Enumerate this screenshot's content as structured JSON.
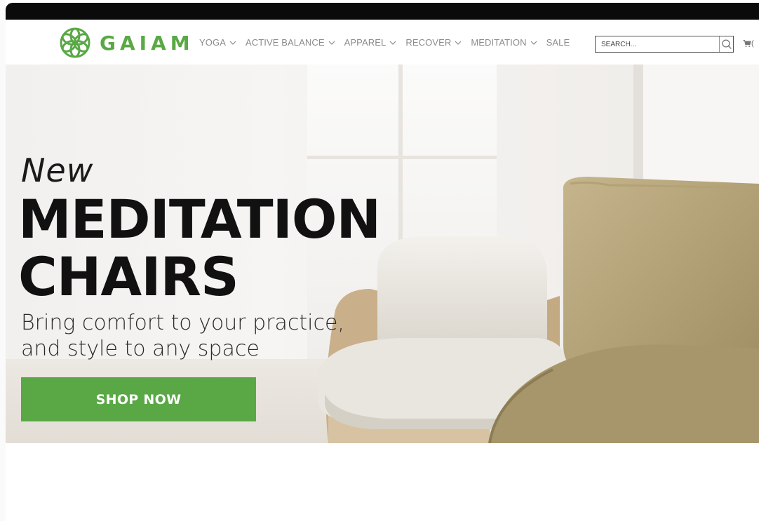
{
  "brand": {
    "name": "GAIAM",
    "color": "#5aa846"
  },
  "nav": {
    "items": [
      {
        "label": "YOGA",
        "has_dropdown": true
      },
      {
        "label": "ACTIVE BALANCE",
        "has_dropdown": true
      },
      {
        "label": "APPAREL",
        "has_dropdown": true
      },
      {
        "label": "RECOVER",
        "has_dropdown": true
      },
      {
        "label": "MEDITATION",
        "has_dropdown": true
      },
      {
        "label": "SALE",
        "has_dropdown": false
      }
    ]
  },
  "search": {
    "placeholder": "SEARCH...",
    "icon": "magnifier-icon"
  },
  "cart": {
    "icon": "cart-icon",
    "count_text": "("
  },
  "hero": {
    "eyebrow": "New",
    "title_line1": "MEDITATION",
    "title_line2": "CHAIRS",
    "subtitle_line1": "Bring comfort to your practice,",
    "subtitle_line2": "and style to any space",
    "cta_label": "SHOP NOW",
    "cta_color": "#59a845"
  }
}
